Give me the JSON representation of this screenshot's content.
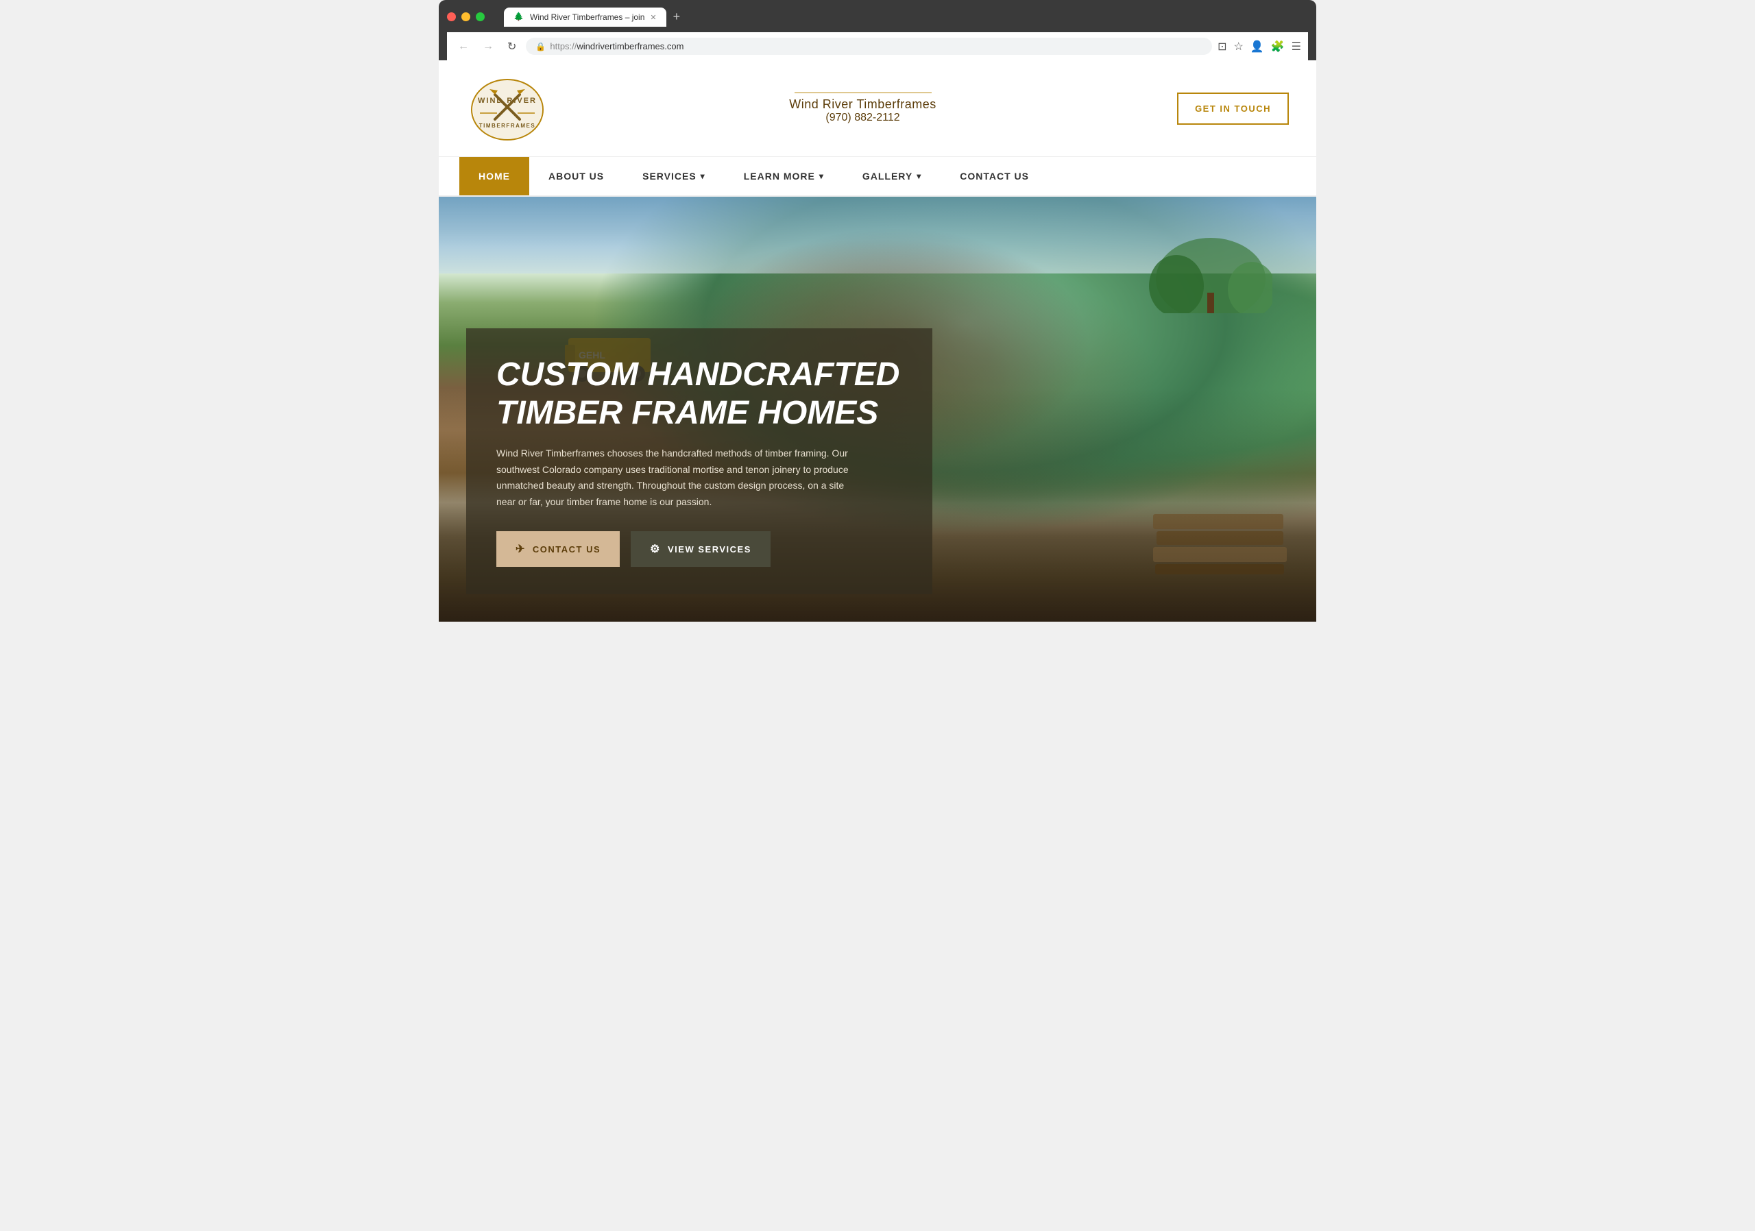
{
  "browser": {
    "tab_title": "Wind River Timberframes – join",
    "tab_favicon": "🌲",
    "url_protocol": "https://",
    "url_domain": "windrivertimberframes.com",
    "new_tab_label": "+"
  },
  "header": {
    "company_name": "Wind River Timberframes",
    "phone": "(970) 882-2112",
    "cta_label": "GET IN TOUCH"
  },
  "nav": {
    "items": [
      {
        "label": "HOME",
        "active": true,
        "has_arrow": false
      },
      {
        "label": "ABOUT US",
        "active": false,
        "has_arrow": false
      },
      {
        "label": "SERVICES",
        "active": false,
        "has_arrow": true
      },
      {
        "label": "LEARN MORE",
        "active": false,
        "has_arrow": true
      },
      {
        "label": "GALLERY",
        "active": false,
        "has_arrow": true
      },
      {
        "label": "CONTACT US",
        "active": false,
        "has_arrow": false
      }
    ]
  },
  "hero": {
    "title_line1": "CUSTOM HANDCRAFTED",
    "title_line2": "TIMBER FRAME HOMES",
    "description": "Wind River Timberframes chooses the handcrafted methods of timber framing. Our southwest Colorado company uses traditional mortise and tenon joinery to produce unmatched beauty and strength. Throughout the custom design process, on a site near or far, your timber frame home is our passion.",
    "btn_contact_label": "CONTACT US",
    "btn_services_label": "VIEW SERVICES",
    "btn_contact_icon": "✉",
    "btn_services_icon": "⚙"
  },
  "logo": {
    "alt": "Wind River Timberframes Logo"
  }
}
